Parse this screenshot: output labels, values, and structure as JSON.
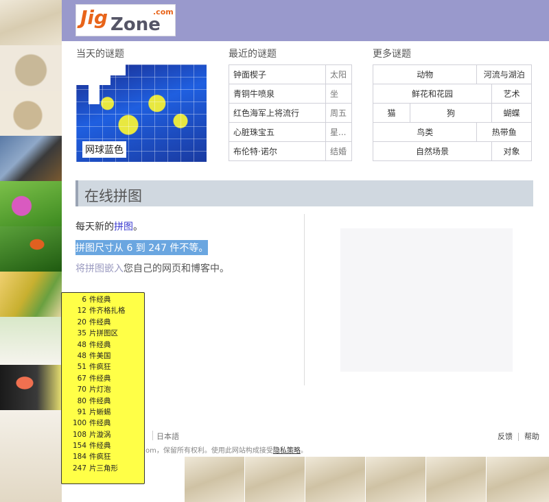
{
  "header": {
    "logo_jig": "Jig",
    "logo_zone": "Zone",
    "logo_com": ".com",
    "bg_color": "#9999cc"
  },
  "sections": {
    "today_title": "当天的谜题",
    "recent_title": "最近的谜题",
    "more_title": "更多谜题"
  },
  "puzzle_of_day": {
    "label": "网球蓝色"
  },
  "recent": [
    {
      "name": "钟面楔子",
      "tag": "太阳"
    },
    {
      "name": "青铜牛喷泉",
      "tag": "坐"
    },
    {
      "name": "红色海军上将流行",
      "tag": "周五"
    },
    {
      "name": "心脏珠宝五",
      "tag": "星..."
    },
    {
      "name": "布伦特·诺尔",
      "tag": "结婚"
    }
  ],
  "more": {
    "row1": [
      "动物",
      "河流与湖泊"
    ],
    "row2": [
      "鲜花和花园",
      "艺术"
    ],
    "row3": [
      "猫",
      "狗",
      "蝴蝶"
    ],
    "row4": [
      "鸟类",
      "热带鱼"
    ],
    "row5": [
      "自然场景",
      "对象"
    ]
  },
  "banner": {
    "title": "在线拼图"
  },
  "main": {
    "line1_pre": "每天新的",
    "line1_link": "拼图",
    "line1_post": "。",
    "line2": "拼图尺寸从 6 到 247 件不等。",
    "line3_a": "将拼图嵌入",
    "line3_b": "您自己的网页和博客中。",
    "highlight_color": "#6aa6e0"
  },
  "footer": {
    "language": "日本語",
    "copyright_pre": "om，保留所有权利。使用此网站构成接受",
    "privacy_link": "隐私策略",
    "copyright_post": "。",
    "feedback": "反馈",
    "help": "帮助"
  },
  "dropdown": {
    "options": [
      {
        "n": "6",
        "label": "件经典"
      },
      {
        "n": "12",
        "label": "件齐格扎格"
      },
      {
        "n": "20",
        "label": "件经典"
      },
      {
        "n": "35",
        "label": "片拼图区"
      },
      {
        "n": "48",
        "label": "件经典"
      },
      {
        "n": "48",
        "label": "件美国"
      },
      {
        "n": "51",
        "label": "件疯狂"
      },
      {
        "n": "67",
        "label": "件经典"
      },
      {
        "n": "70",
        "label": "片灯泡"
      },
      {
        "n": "80",
        "label": "件经典"
      },
      {
        "n": "91",
        "label": "片蜥蜴"
      },
      {
        "n": "100",
        "label": "件经典"
      },
      {
        "n": "108",
        "label": "片漩涡"
      },
      {
        "n": "154",
        "label": "件经典"
      },
      {
        "n": "184",
        "label": "件疯狂"
      },
      {
        "n": "247",
        "label": "片三角形"
      }
    ],
    "bg_color": "#ffff47"
  },
  "side_thumbs": [
    "wheat-thumbnail",
    "cat-thumbnail",
    "kitten-thumbnail",
    "eagle-thumbnail",
    "flower-bee-thumbnail",
    "toucan-thumbnail",
    "leaves-thumbnail",
    "fade-thumbnail",
    "flamingo-thumbnail",
    "sepia-thumbnail"
  ],
  "bottom_thumbs": [
    "penguin-thumbnail",
    "boat-thumbnail",
    "wheel-thumbnail",
    "squirrel-thumbnail",
    "dandelion-thumbnail",
    "deer-thumbnail"
  ]
}
